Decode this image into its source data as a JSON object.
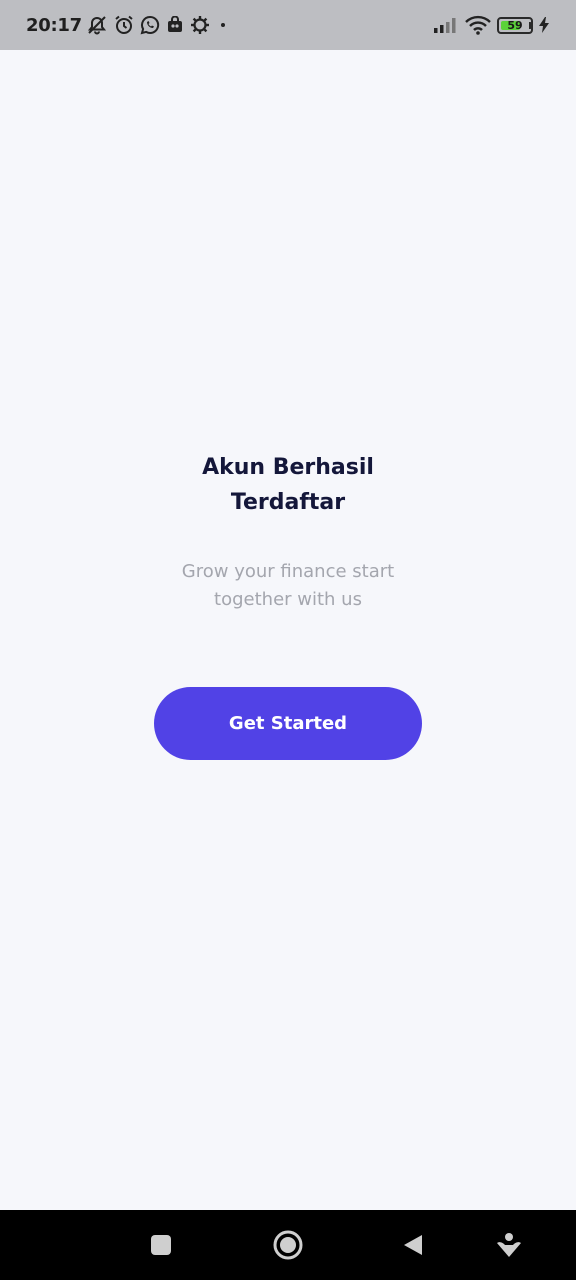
{
  "status_bar": {
    "time": "20:17",
    "battery_level": "59",
    "battery_percent": 59,
    "icons_left": [
      "mute-icon",
      "alarm-icon",
      "whatsapp-icon",
      "bag-icon",
      "gear-icon",
      "dot-icon"
    ],
    "icons_right": [
      "signal-icon",
      "wifi-icon",
      "battery-icon",
      "charging-icon"
    ]
  },
  "main": {
    "title_line1": "Akun Berhasil",
    "title_line2": "Terdaftar",
    "subtitle_line1": "Grow your finance start",
    "subtitle_line2": "together with us",
    "button_label": "Get Started"
  },
  "nav_bar": {
    "buttons": [
      "recents-button",
      "home-button",
      "back-button",
      "menu-button"
    ]
  },
  "colors": {
    "accent": "#5142e6",
    "background": "#f6f7fb",
    "title": "#14173a",
    "subtitle": "#a4a6ae"
  }
}
